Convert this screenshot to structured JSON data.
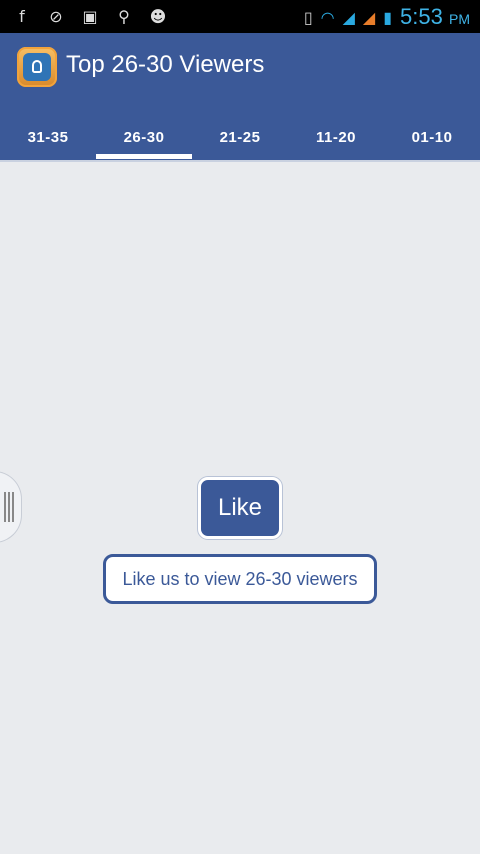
{
  "status_bar": {
    "left_icons": [
      "facebook-icon",
      "blocked-icon",
      "image-icon",
      "usb-icon",
      "android-icon"
    ],
    "right_icons": [
      "vibrate-icon",
      "wifi-icon",
      "signal-1-icon",
      "signal-2-icon",
      "battery-charging-icon"
    ],
    "time": "5:53",
    "ampm": "PM"
  },
  "app_bar": {
    "title": "Top 26-30 Viewers",
    "icon": "lock-icon",
    "color": "#3b5998"
  },
  "tabs": [
    {
      "label": "31-35",
      "active": false
    },
    {
      "label": "26-30",
      "active": true
    },
    {
      "label": "21-25",
      "active": false
    },
    {
      "label": "11-20",
      "active": false
    },
    {
      "label": "01-10",
      "active": false
    }
  ],
  "main": {
    "like_label": "Like",
    "notice": "Like us to view 26-30 viewers"
  }
}
